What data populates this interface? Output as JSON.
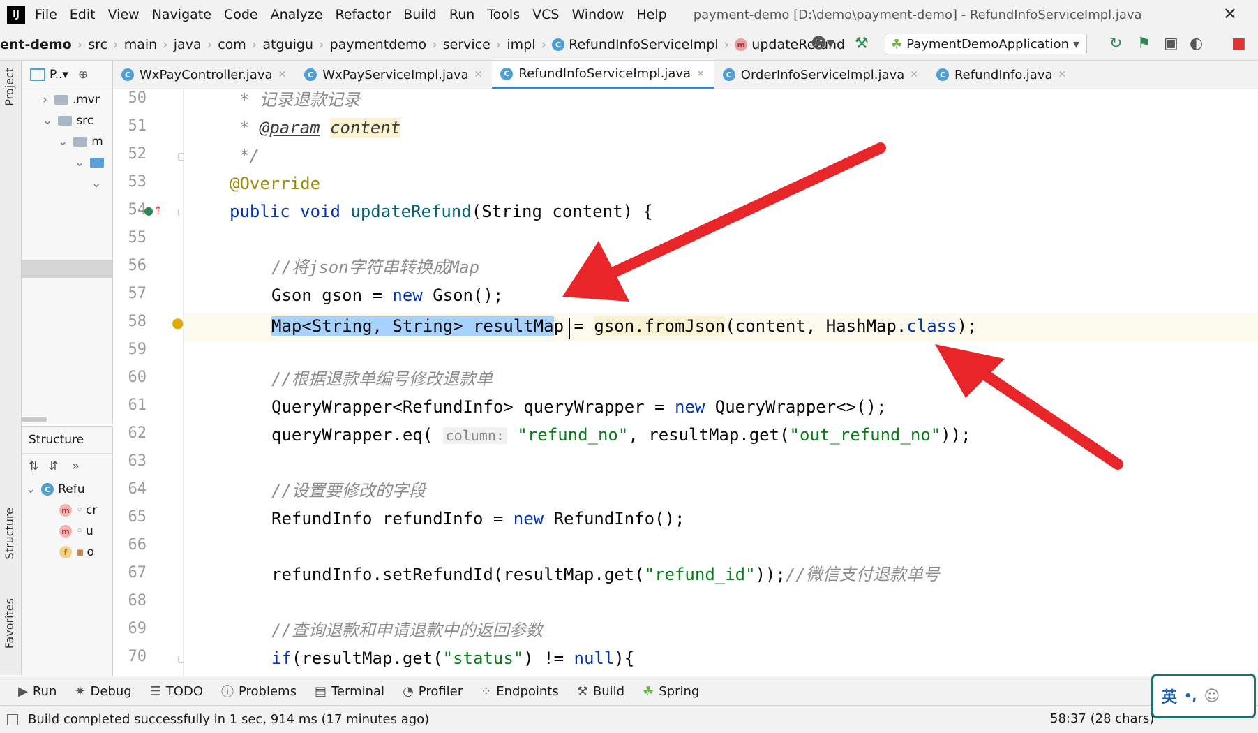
{
  "menu": {
    "app_logo": "IJ",
    "items": [
      "File",
      "Edit",
      "View",
      "Navigate",
      "Code",
      "Analyze",
      "Refactor",
      "Build",
      "Run",
      "Tools",
      "VCS",
      "Window",
      "Help"
    ],
    "window_title": "payment-demo [D:\\demo\\payment-demo] - RefundInfoServiceImpl.java"
  },
  "nav": {
    "crumbs": [
      "ent-demo",
      "src",
      "main",
      "java",
      "com",
      "atguigu",
      "paymentdemo",
      "service",
      "impl",
      "RefundInfoServiceImpl",
      "updateRefund"
    ],
    "run_config": "PaymentDemoApplication"
  },
  "left_strip": {
    "project": "Project",
    "structure": "Structure",
    "favorites": "Favorites"
  },
  "project_panel": {
    "header": "P..▾",
    "rows": [
      ".mvr",
      "src",
      "m"
    ]
  },
  "structure_panel": {
    "title": "Structure",
    "root": "Refu",
    "items": [
      {
        "badge": "m",
        "label": "cr"
      },
      {
        "badge": "m",
        "label": "u"
      },
      {
        "badge": "f",
        "label": "o"
      }
    ]
  },
  "tabs": [
    {
      "label": "WxPayController.java",
      "active": false
    },
    {
      "label": "WxPayServiceImpl.java",
      "active": false
    },
    {
      "label": "RefundInfoServiceImpl.java",
      "active": true
    },
    {
      "label": "OrderInfoServiceImpl.java",
      "active": false
    },
    {
      "label": "RefundInfo.java",
      "active": false
    }
  ],
  "editor": {
    "line_numbers": [
      "50",
      "51",
      "52",
      "53",
      "54",
      "55",
      "56",
      "57",
      "58",
      "59",
      "60",
      "61",
      "62",
      "63",
      "64",
      "65",
      "66",
      "67",
      "68",
      "69",
      "70"
    ],
    "lines": {
      "l50": "记录退款记录",
      "l51_tag": "@param",
      "l51_name": "content",
      "l53": "@Override",
      "l54_kw": "public void ",
      "l54_fn": "updateRefund",
      "l54_rest": "(String content) {",
      "l56": "//将json字符串转换成Map",
      "l57_a": "Gson gson = ",
      "l57_kw": "new",
      "l57_b": " Gson();",
      "l58_sel": "Map<String, String> resultMa",
      "l58_a": "p = ",
      "l58_warn": "gson.fromJson",
      "l58_b": "(content, HashMap.",
      "l58_kw": "class",
      "l58_c": ");",
      "l60": "//根据退款单编号修改退款单",
      "l61_a": "QueryWrapper<RefundInfo> queryWrapper = ",
      "l61_kw": "new",
      "l61_b": " QueryWrapper<>();",
      "l62_a": "queryWrapper.eq( ",
      "l62_hint": "column:",
      "l62_str1": "\"refund_no\"",
      "l62_b": ", resultMap.get(",
      "l62_str2": "\"out_refund_no\"",
      "l62_c": "));",
      "l64": "//设置要修改的字段",
      "l65_a": "RefundInfo refundInfo = ",
      "l65_kw": "new",
      "l65_b": " RefundInfo();",
      "l67_a": "refundInfo.setRefundId(resultMap.get(",
      "l67_str": "\"refund_id\"",
      "l67_b": "));",
      "l67_cmt": "//微信支付退款单号",
      "l69": "//查询退款和申请退款中的返回参数",
      "l70_kw": "if",
      "l70_a": "(resultMap.get(",
      "l70_str": "\"status\"",
      "l70_b": ") != ",
      "l70_null": "null",
      "l70_c": "){"
    }
  },
  "bottom_tools": [
    "Run",
    "Debug",
    "TODO",
    "Problems",
    "Terminal",
    "Profiler",
    "Endpoints",
    "Build",
    "Spring"
  ],
  "status": {
    "message": "Build completed successfully in 1 sec, 914 ms (17 minutes ago)",
    "position": "58:37 (28 chars)",
    "ime": "英"
  },
  "colors": {
    "arrow": "#e8262a",
    "selection": "#a6d2ff",
    "tab_accent": "#4083c9"
  }
}
